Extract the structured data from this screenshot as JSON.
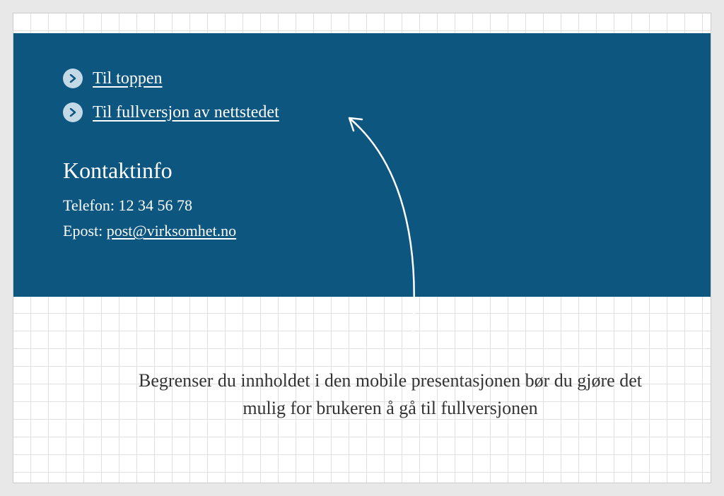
{
  "footer": {
    "links": [
      {
        "label": "Til toppen"
      },
      {
        "label": "Til fullversjon av nettstedet"
      }
    ],
    "contact": {
      "heading": "Kontaktinfo",
      "phone_label": "Telefon: ",
      "phone_value": "12 34 56 78",
      "email_label": "Epost: ",
      "email_value": "post@virksomhet.no"
    }
  },
  "annotation": {
    "text": "Begrenser du innholdet i den mobile presentasjonen bør du gjøre det mulig for brukeren å gå til fullversjonen"
  },
  "colors": {
    "panel_bg": "#0d5680",
    "icon_bg": "#c3dae6",
    "icon_chevron": "#0d5680"
  }
}
